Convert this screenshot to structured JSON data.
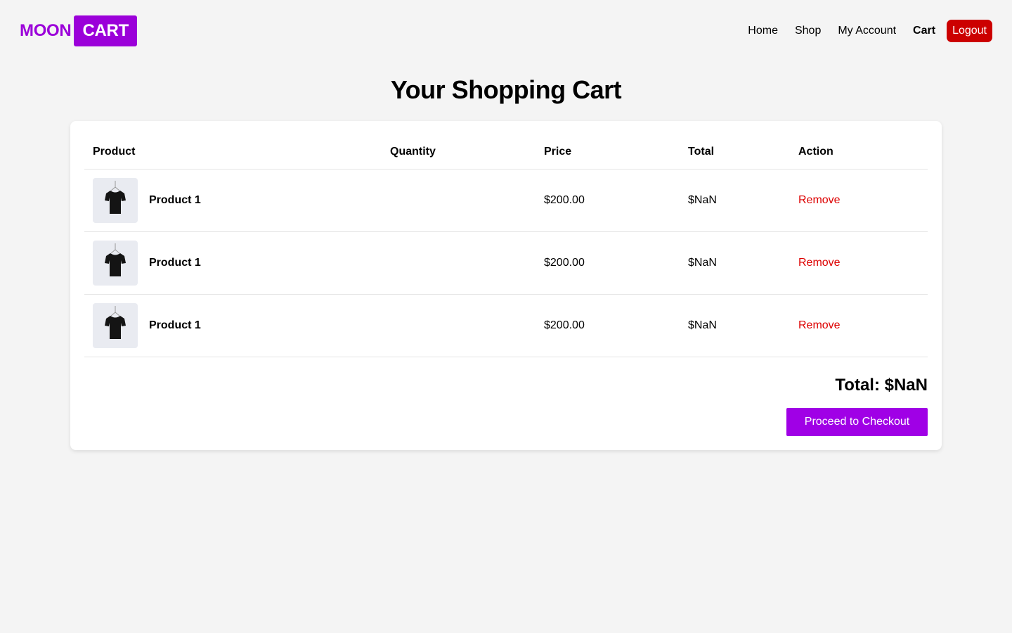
{
  "brand": {
    "part1": "MOON",
    "part2": "CART"
  },
  "nav": {
    "items": [
      {
        "label": "Home",
        "active": false
      },
      {
        "label": "Shop",
        "active": false
      },
      {
        "label": "My Account",
        "active": false
      },
      {
        "label": "Cart",
        "active": true
      }
    ],
    "logout_label": "Logout"
  },
  "page_title": "Your Shopping Cart",
  "table": {
    "headers": [
      "Product",
      "Quantity",
      "Price",
      "Total",
      "Action"
    ],
    "rows": [
      {
        "product": "Product 1",
        "quantity": "",
        "price": "$200.00",
        "total": "$NaN",
        "action": "Remove",
        "image": "tshirt-icon"
      },
      {
        "product": "Product 1",
        "quantity": "",
        "price": "$200.00",
        "total": "$NaN",
        "action": "Remove",
        "image": "tshirt-icon"
      },
      {
        "product": "Product 1",
        "quantity": "",
        "price": "$200.00",
        "total": "$NaN",
        "action": "Remove",
        "image": "tshirt-icon"
      }
    ]
  },
  "summary": {
    "total_label": "Total: $NaN",
    "checkout_label": "Proceed to Checkout"
  },
  "colors": {
    "brand": "#9b00d9",
    "logout": "#cc0000",
    "remove": "#dd0000",
    "checkout": "#a000e6",
    "background": "#f4f4f4"
  }
}
